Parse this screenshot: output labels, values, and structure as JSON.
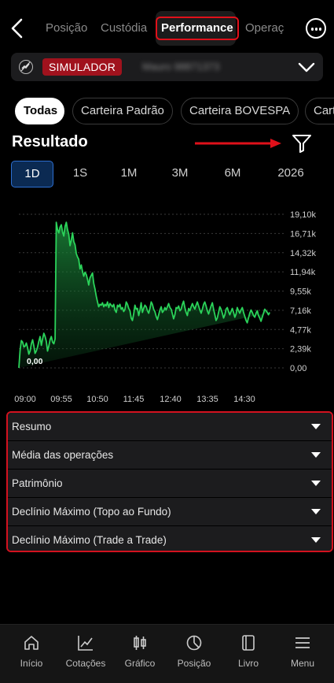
{
  "nav": {
    "tabs": [
      {
        "label": "Posição"
      },
      {
        "label": "Custódia"
      },
      {
        "label": "Performance"
      },
      {
        "label": "Operaç"
      }
    ],
    "active_tab": "Performance",
    "back_icon": "chevron-left-icon",
    "more_icon": "more-horizontal-icon"
  },
  "account": {
    "badge": "SIMULADOR",
    "name": "Mauro   98871373",
    "badge_color": "#a0121d"
  },
  "chips": [
    {
      "label": "Todas"
    },
    {
      "label": "Carteira Padrão"
    },
    {
      "label": "Carteira BOVESPA"
    },
    {
      "label": "Cart"
    }
  ],
  "section": {
    "title": "Resultado"
  },
  "periods": [
    {
      "label": "1D"
    },
    {
      "label": "1S"
    },
    {
      "label": "1M"
    },
    {
      "label": "3M"
    },
    {
      "label": "6M"
    },
    {
      "label": "2026"
    }
  ],
  "chart_data": {
    "type": "area",
    "color": "#2bd35a",
    "y_ticks": [
      "19,10k",
      "16,71k",
      "14,32k",
      "11,94k",
      "9,55k",
      "7,16k",
      "4,77k",
      "2,39k",
      "0,00"
    ],
    "x_ticks": [
      "09:00",
      "09:55",
      "10:50",
      "11:45",
      "12:40",
      "13:35",
      "14:30"
    ],
    "ylim": [
      0,
      19100
    ],
    "start_label": "0,00",
    "x": [
      0.0,
      0.03,
      0.06,
      0.09,
      0.12,
      0.15,
      0.18,
      0.21,
      0.24,
      0.27,
      0.3,
      0.33,
      0.36,
      0.39,
      0.42,
      0.45,
      0.48,
      0.51,
      0.54,
      0.57,
      0.6,
      0.63,
      0.66,
      0.69,
      0.72,
      0.75,
      0.78,
      0.81,
      0.84,
      0.87,
      0.9,
      0.93,
      0.96,
      0.99,
      1.02,
      1.05,
      1.08,
      1.11,
      1.14,
      1.17,
      1.2,
      1.23,
      1.26,
      1.29,
      1.32,
      1.35,
      1.38,
      1.41,
      1.44,
      1.47,
      1.5,
      1.53,
      1.56,
      1.59,
      1.62,
      1.65,
      1.68,
      1.71,
      1.74,
      1.77,
      1.8,
      1.83,
      1.86,
      1.89,
      1.92,
      1.95,
      1.98,
      2.01,
      2.04,
      2.07,
      2.1,
      2.13,
      2.16,
      2.19,
      2.22,
      2.25,
      2.28,
      2.31,
      2.34,
      2.37,
      2.4,
      2.43,
      2.46,
      2.49,
      2.52,
      2.55,
      2.58,
      2.61,
      2.64,
      2.67,
      2.7,
      2.73,
      2.76,
      2.79,
      2.82,
      2.85,
      2.88,
      2.91,
      2.94,
      2.97,
      3.0,
      3.03,
      3.06,
      3.09,
      3.12,
      3.15,
      3.18,
      3.21,
      3.24,
      3.27,
      3.3,
      3.33,
      3.36,
      3.39,
      3.42,
      3.45,
      3.48,
      3.51,
      3.54,
      3.57,
      3.6,
      3.63,
      3.66,
      3.69,
      3.72,
      3.75,
      3.78,
      3.81,
      3.84,
      3.87,
      3.9,
      3.93,
      3.96,
      3.99,
      4.02,
      4.05,
      4.08,
      4.11,
      4.14,
      4.17,
      4.2,
      4.23,
      4.26,
      4.29,
      4.32,
      4.35,
      4.38,
      4.41,
      4.44,
      4.47,
      4.5,
      4.53,
      4.56,
      4.59,
      4.62,
      4.65,
      4.68,
      4.71,
      4.74,
      4.77,
      4.8,
      4.83,
      4.86,
      4.89,
      4.92,
      4.95,
      4.98,
      5.01,
      5.04,
      5.07,
      5.1,
      5.13,
      5.16,
      5.19,
      5.22,
      5.25,
      5.28,
      5.31,
      5.34,
      5.37,
      5.4,
      5.43,
      5.46,
      5.49,
      5.52,
      5.55,
      5.58,
      5.61,
      5.64,
      5.67,
      5.7,
      5.73,
      5.76,
      5.79,
      5.82,
      5.85,
      5.88,
      5.91,
      5.94,
      5.97,
      6.0,
      6.03,
      6.06,
      6.09,
      6.12
    ],
    "values": [
      0,
      2200,
      3400,
      3200,
      2600,
      2700,
      3100,
      2500,
      1700,
      2100,
      3000,
      3500,
      2700,
      1800,
      2100,
      2600,
      3300,
      3900,
      2800,
      3600,
      4300,
      3900,
      3300,
      2100,
      2700,
      3500,
      3900,
      3200,
      3000,
      3600,
      18100,
      17200,
      16800,
      17500,
      17800,
      16900,
      16400,
      17600,
      18100,
      17200,
      16600,
      15200,
      15900,
      16800,
      15700,
      15300,
      14200,
      13800,
      13500,
      12300,
      12800,
      12000,
      11400,
      11900,
      11600,
      11000,
      10300,
      11200,
      11500,
      11800,
      10500,
      9800,
      8900,
      8200,
      7600,
      7900,
      7800,
      8100,
      7600,
      7900,
      7700,
      8200,
      7500,
      8000,
      7800,
      7600,
      7900,
      7200,
      6900,
      7800,
      7600,
      7900,
      7300,
      7500,
      7000,
      7300,
      8200,
      7900,
      7400,
      7100,
      6200,
      5900,
      6700,
      7800,
      7300,
      7400,
      6500,
      7200,
      8100,
      6900,
      7400,
      7800,
      7600,
      7100,
      6800,
      7400,
      8200,
      7900,
      7300,
      7000,
      6400,
      6000,
      6600,
      7200,
      7600,
      6900,
      7100,
      7500,
      7200,
      7600,
      8000,
      7500,
      7300,
      6700,
      6100,
      6600,
      7500,
      7400,
      7700,
      7100,
      7300,
      7900,
      8300,
      7500,
      6900,
      6500,
      7400,
      7100,
      7600,
      8000,
      7600,
      7300,
      7800,
      8200,
      7700,
      7200,
      6800,
      7300,
      7900,
      8200,
      7700,
      7100,
      6700,
      7200,
      7700,
      8100,
      7300,
      6600,
      5900,
      6200,
      6900,
      7600,
      7300,
      6800,
      6200,
      6600,
      7300,
      7500,
      7000,
      6600,
      7000,
      7400,
      6900,
      6300,
      6700,
      7500,
      7100,
      6800,
      7200,
      7500,
      6900,
      6400,
      5900,
      5600,
      6200,
      6800,
      7200,
      6900,
      6500,
      6300,
      6800,
      7100,
      6500,
      6200,
      5800,
      6300,
      6800,
      7300,
      7100,
      6900,
      6600,
      6900
    ]
  },
  "accordion": [
    {
      "label": "Resumo"
    },
    {
      "label": "Média das operações"
    },
    {
      "label": "Patrimônio"
    },
    {
      "label": "Declínio Máximo (Topo ao Fundo)"
    },
    {
      "label": "Declínio Máximo (Trade a Trade)"
    }
  ],
  "bottom_nav": [
    {
      "label": "Início",
      "icon": "home-icon"
    },
    {
      "label": "Cotações",
      "icon": "chart-line-icon"
    },
    {
      "label": "Gráfico",
      "icon": "candlestick-icon"
    },
    {
      "label": "Posição",
      "icon": "pie-chart-icon"
    },
    {
      "label": "Livro",
      "icon": "book-icon"
    },
    {
      "label": "Menu",
      "icon": "menu-icon"
    }
  ]
}
